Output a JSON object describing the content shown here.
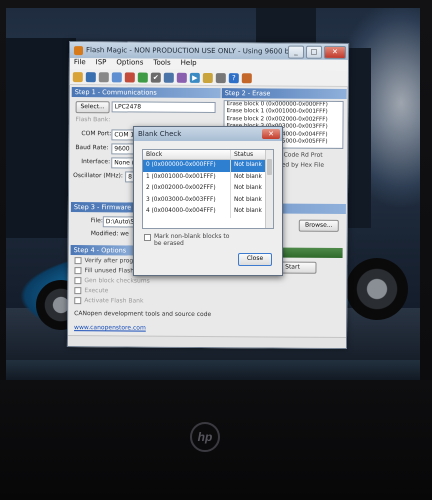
{
  "window": {
    "title": "Flash Magic - NON PRODUCTION USE ONLY - Using 9600 baud",
    "menu": [
      "File",
      "ISP",
      "Options",
      "Tools",
      "Help"
    ],
    "minimize": "_",
    "maximize": "□",
    "close": "✕"
  },
  "step1": {
    "header": "Step 1 - Communications",
    "select_label": "Select...",
    "device": "LPC2478",
    "flash_bank_label": "Flash Bank:",
    "com_port_label": "COM Port:",
    "com_port_value": "COM 1",
    "baud_rate_label": "Baud Rate:",
    "baud_rate_value": "9600",
    "interface_label": "Interface:",
    "interface_value": "None (IS",
    "oscillator_label": "Oscillator (MHz):",
    "oscillator_value": "8"
  },
  "step2": {
    "header": "Step 2 - Erase",
    "erase_items": [
      "Erase block 0 (0x000000-0x000FFF)",
      "Erase block 1 (0x001000-0x001FFF)",
      "Erase block 2 (0x002000-0x002FFF)",
      "Erase block 3 (0x003000-0x003FFF)",
      "Erase block 4 (0x004000-0x004FFF)",
      "Erase block 5 (0x005000-0x005FFF)"
    ],
    "erase_all_label": "Erase all Flash+Code Rd Prot",
    "erase_used_label": "Erase blocks used by Hex File"
  },
  "step3": {
    "header": "Step 3 - Firmware",
    "file_label": "File:",
    "file_value": "D:\\Auto\\Sour",
    "modified_label": "Modified: we",
    "browse_label": "Browse..."
  },
  "step4": {
    "header": "Step 4 - Options",
    "options": [
      {
        "label": "Verify after programming",
        "enabled": true
      },
      {
        "label": "Fill unused Flash",
        "enabled": true
      },
      {
        "label": "Gen block checksums",
        "enabled": false
      },
      {
        "label": "Execute",
        "enabled": false
      },
      {
        "label": "Activate Flash Bank",
        "enabled": false
      }
    ]
  },
  "step5": {
    "start_label": "Start"
  },
  "footer": {
    "promo": "CANopen development tools and source code",
    "link": "www.canopenstore.com"
  },
  "dialog": {
    "title": "Blank Check",
    "close": "✕",
    "columns": [
      "Block",
      "Status"
    ],
    "rows": [
      {
        "block": "0 (0x000000-0x000FFF)",
        "status": "Not blank",
        "selected": true
      },
      {
        "block": "1 (0x001000-0x001FFF)",
        "status": "Not blank",
        "selected": false
      },
      {
        "block": "2 (0x002000-0x002FFF)",
        "status": "Not blank",
        "selected": false
      },
      {
        "block": "3 (0x003000-0x003FFF)",
        "status": "Not blank",
        "selected": false
      },
      {
        "block": "4 (0x004000-0x004FFF)",
        "status": "Not blank",
        "selected": false
      }
    ],
    "mark_label": "Mark non-blank blocks to be erased",
    "close_button": "Close"
  },
  "laptop": {
    "brand": "hp"
  }
}
